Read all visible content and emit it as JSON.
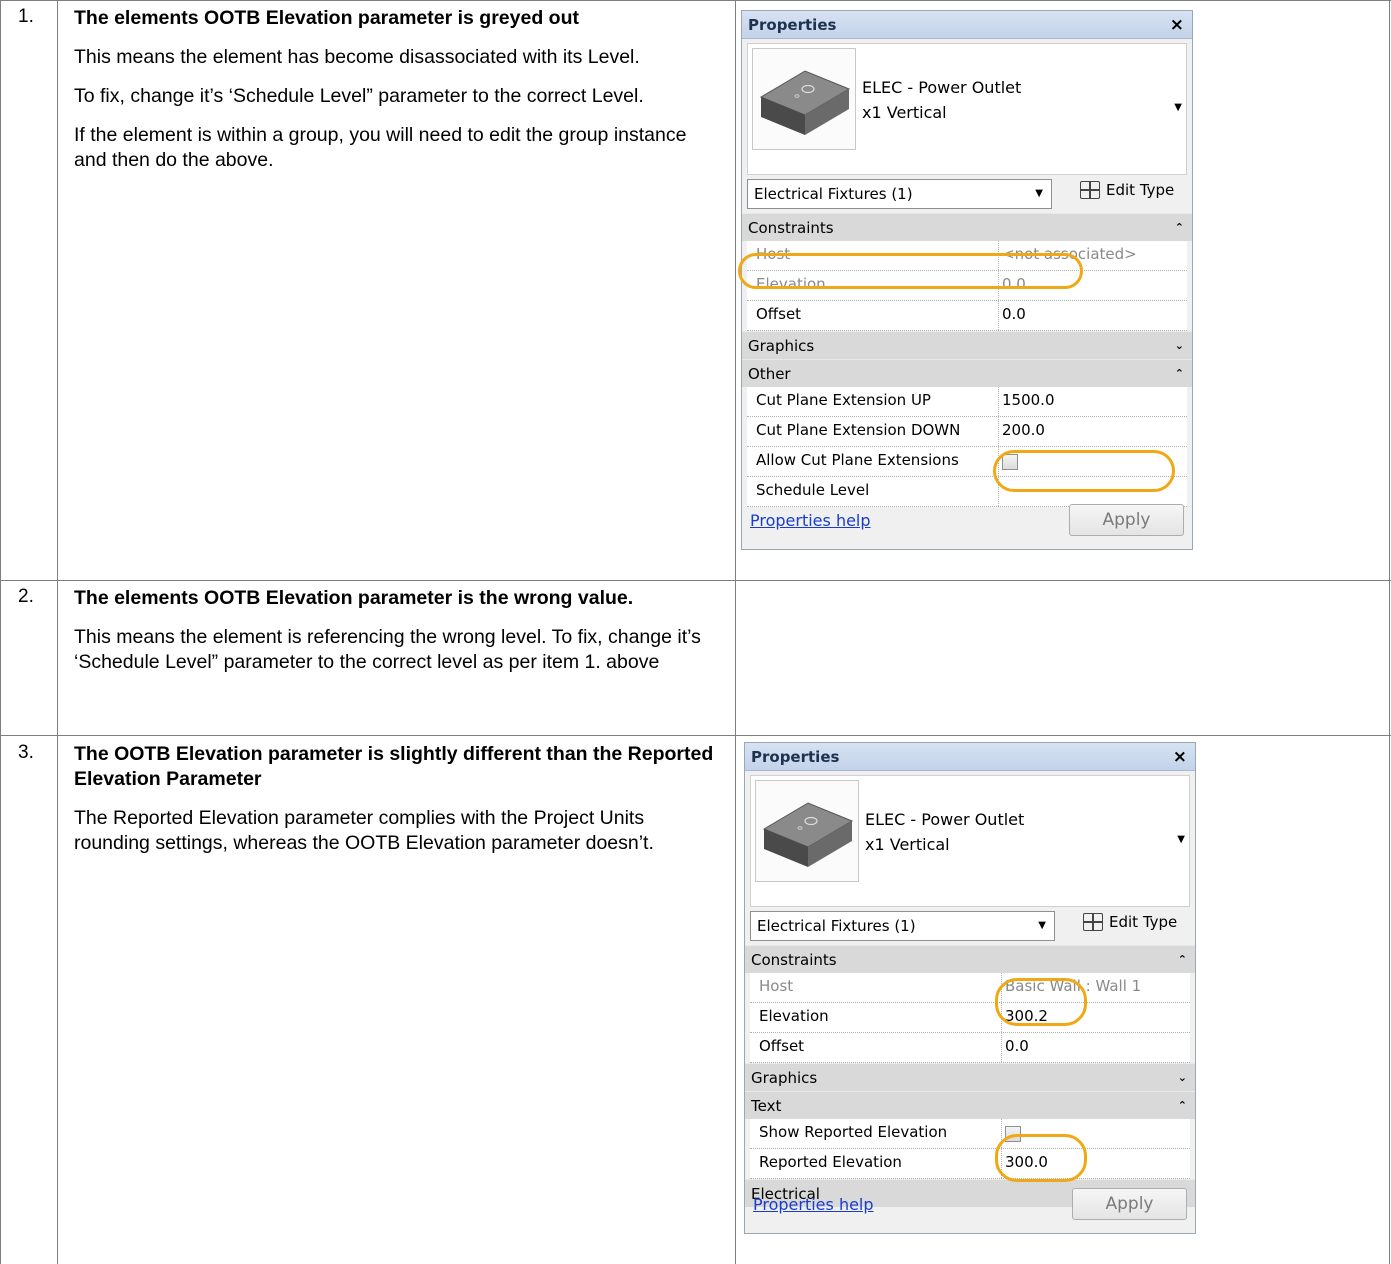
{
  "rows": [
    {
      "number": "1.",
      "heading": "The elements OOTB Elevation parameter is greyed out",
      "paragraphs": [
        "This means the element has become disassociated with its Level.",
        "To fix, change it’s ‘Schedule Level” parameter to the correct Level.",
        "If the element is within a group, you will need to edit the group instance and then do the above."
      ]
    },
    {
      "number": "2.",
      "heading": "The elements OOTB Elevation parameter is the wrong value.",
      "paragraphs": [
        "This means the element is referencing the wrong level. To fix, change it’s ‘Schedule Level” parameter to the correct level as per item 1. above"
      ]
    },
    {
      "number": "3.",
      "heading": "The OOTB Elevation parameter is slightly different than the Reported Elevation Parameter",
      "paragraphs": [
        "The Reported Elevation parameter complies with the Project Units rounding settings, whereas the OOTB Elevation parameter doesn’t."
      ]
    }
  ],
  "panel1": {
    "title": "Properties",
    "close": "×",
    "type_line1": "ELEC - Power Outlet",
    "type_line2": "x1 Vertical",
    "selector": "Electrical Fixtures (1)",
    "edit_type": "Edit Type",
    "groups": [
      {
        "label": "Constraints",
        "chevron": "up"
      },
      {
        "label": "Graphics",
        "chevron": "down"
      },
      {
        "label": "Other",
        "chevron": "up"
      }
    ],
    "constraints": [
      {
        "key": "Host",
        "value": "<not associated>",
        "greyed": true
      },
      {
        "key": "Elevation",
        "value": "0.0",
        "greyed": true
      },
      {
        "key": "Offset",
        "value": "0.0",
        "greyed": false
      }
    ],
    "other": [
      {
        "key": "Cut Plane Extension UP",
        "value": "1500.0"
      },
      {
        "key": "Cut Plane Extension DOWN",
        "value": "200.0"
      },
      {
        "key": "Allow Cut Plane Extensions",
        "value": ""
      },
      {
        "key": "Schedule Level",
        "value": ""
      }
    ],
    "help": "Properties help",
    "apply": "Apply"
  },
  "panel2": {
    "title": "Properties",
    "close": "×",
    "type_line1": "ELEC - Power Outlet",
    "type_line2": "x1 Vertical",
    "selector": "Electrical Fixtures (1)",
    "edit_type": "Edit Type",
    "groups": [
      {
        "label": "Constraints",
        "chevron": "up"
      },
      {
        "label": "Graphics",
        "chevron": "down"
      },
      {
        "label": "Text",
        "chevron": "up"
      },
      {
        "label": "Electrical",
        "chevron": "down"
      }
    ],
    "constraints": [
      {
        "key": "Host",
        "value": "Basic Wall : Wall 1",
        "greyed": true
      },
      {
        "key": "Elevation",
        "value": "300.2",
        "greyed": false
      },
      {
        "key": "Offset",
        "value": "0.0",
        "greyed": false
      }
    ],
    "text": [
      {
        "key": "Show Reported Elevation",
        "value": ""
      },
      {
        "key": "Reported Elevation",
        "value": "300.0"
      }
    ],
    "help": "Properties help",
    "apply": "Apply"
  },
  "colors": {
    "highlight_ring": "#f0a814",
    "link": "#1a3ccc",
    "group_band": "#d9d9d9"
  }
}
